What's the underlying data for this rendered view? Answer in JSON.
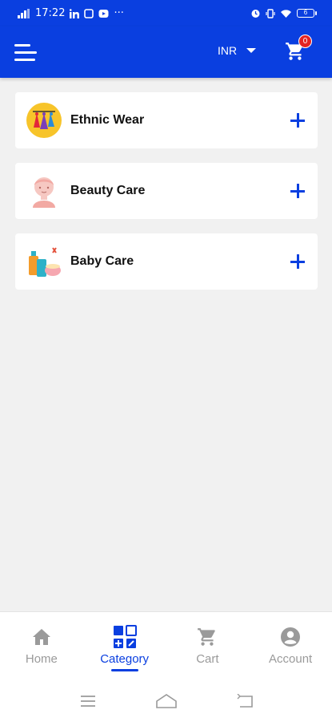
{
  "status_bar": {
    "time": "17:22",
    "left_icons": [
      "signal-icon",
      "linkedin-icon",
      "notification-icon",
      "youtube-icon"
    ],
    "more": "···",
    "battery": "6"
  },
  "header": {
    "currency": "INR",
    "cart_count": "0",
    "accent": "#0a3fe0",
    "badge_color": "#e32323"
  },
  "categories": [
    {
      "label": "Ethnic Wear",
      "icon": "ethnic-wear-icon"
    },
    {
      "label": "Beauty Care",
      "icon": "beauty-care-icon"
    },
    {
      "label": "Baby Care",
      "icon": "baby-care-icon"
    }
  ],
  "bottom_nav": {
    "items": [
      {
        "label": "Home",
        "icon": "home-icon",
        "active": false
      },
      {
        "label": "Category",
        "icon": "category-icon",
        "active": true
      },
      {
        "label": "Cart",
        "icon": "cart-icon",
        "active": false
      },
      {
        "label": "Account",
        "icon": "account-icon",
        "active": false
      }
    ]
  },
  "system_nav": [
    "menu-icon",
    "home-outline-icon",
    "back-icon"
  ]
}
